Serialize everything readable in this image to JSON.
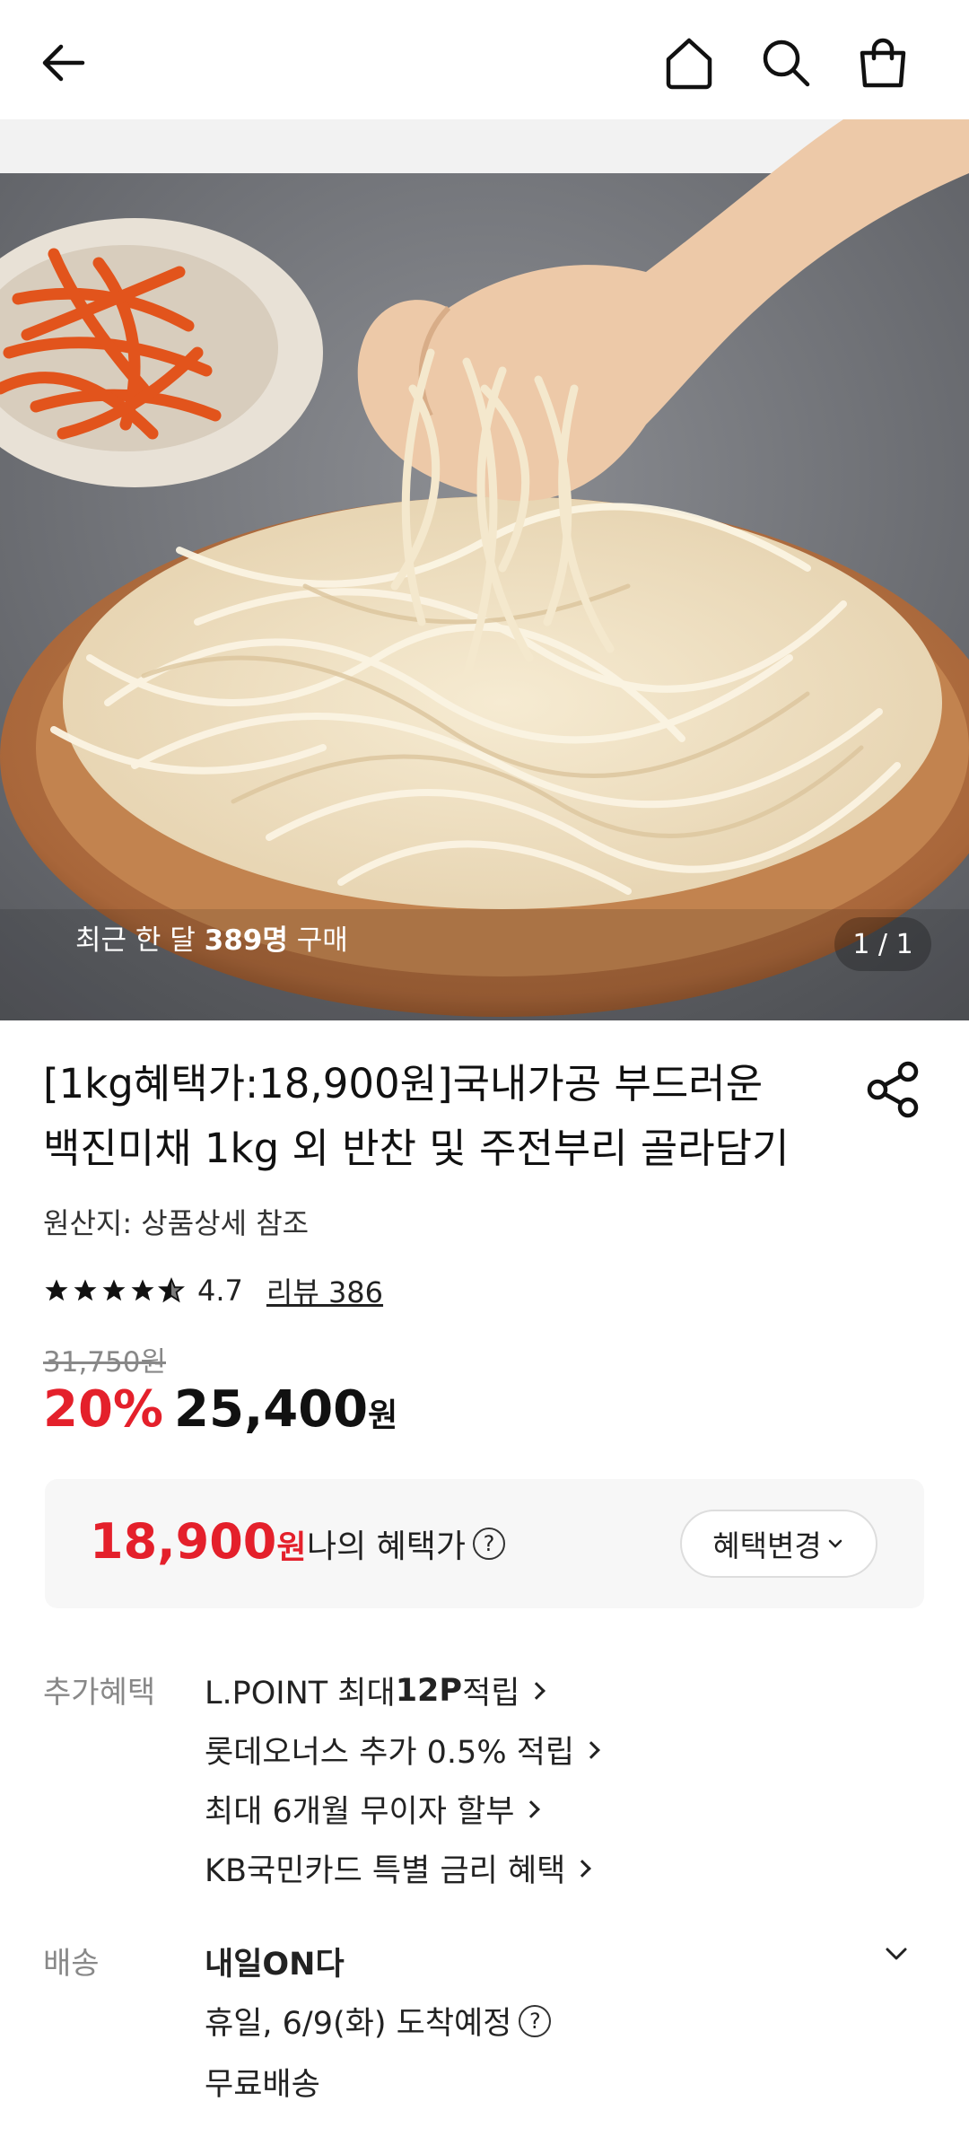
{
  "header": {
    "back_icon": "arrow-left-icon",
    "home_icon": "home-icon",
    "search_icon": "search-icon",
    "cart_icon": "shopping-bag-icon"
  },
  "gallery": {
    "recent_prefix": "최근 한 달 ",
    "recent_count": "389명",
    "recent_suffix": " 구매",
    "pager": "1 / 1"
  },
  "product": {
    "title_line1": "[1kg혜택가:18,900원]국내가공 부드러운",
    "title_line2": "백진미채 1kg 외 반찬 및 주전부리 골라담기",
    "origin": "원산지: 상품상세 참조",
    "rating": "4.7",
    "rating_value": 4.7,
    "review": "리뷰 386",
    "original_price": "31,750원",
    "discount": "20%",
    "price": "25,400",
    "price_unit": "원"
  },
  "benefit": {
    "price": "18,900",
    "unit": "원",
    "label": "나의 혜택가",
    "change_button": "혜택변경"
  },
  "extra_benefits": {
    "label": "추가혜택",
    "items": [
      {
        "pre": "L.POINT 최대 ",
        "bold": "12P",
        "post": " 적립"
      },
      {
        "pre": "롯데오너스 추가 0.5% 적립",
        "bold": "",
        "post": ""
      },
      {
        "pre": "최대 6개월 무이자 할부",
        "bold": "",
        "post": ""
      },
      {
        "pre": "KB국민카드 특별 금리 혜택",
        "bold": "",
        "post": ""
      }
    ]
  },
  "shipping": {
    "label": "배송",
    "title": "내일ON다",
    "eta": "휴일, 6/9(화) 도착예정",
    "fee": "무료배송"
  },
  "colors": {
    "accent_red": "#e4202b",
    "text": "#111111",
    "muted": "#888888",
    "box_bg": "#f7f7f7"
  }
}
